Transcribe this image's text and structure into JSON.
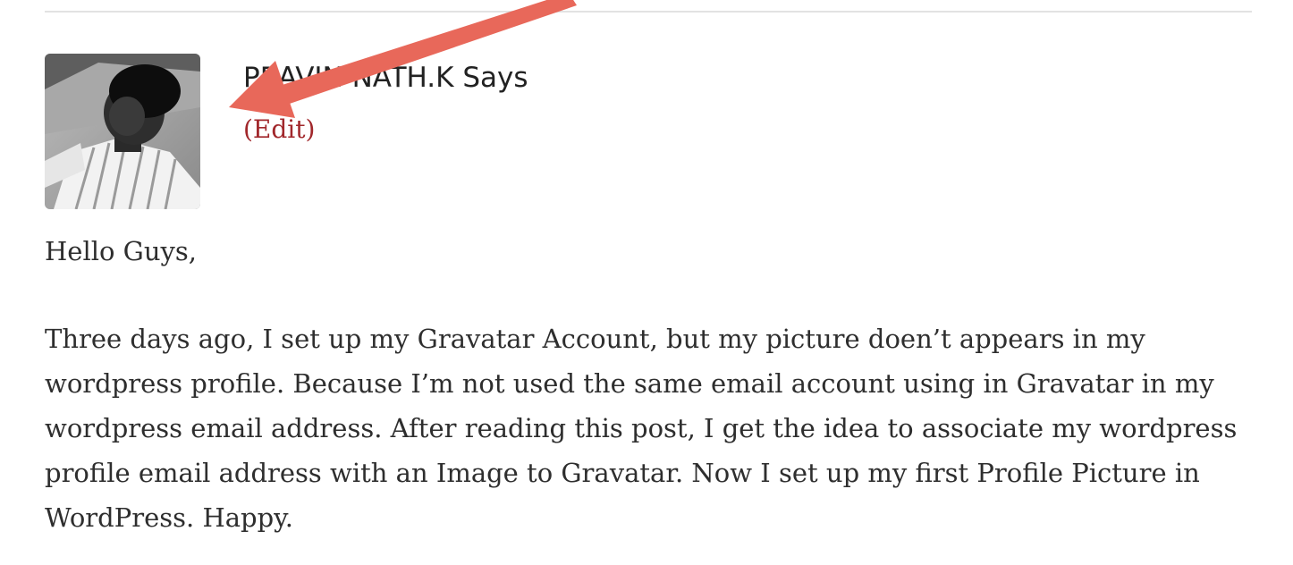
{
  "comment": {
    "author_line": "PRAVIN NATH.K Says",
    "edit_label": "(Edit)",
    "greeting": "Hello Guys,",
    "body": "Three days ago, I set up my Gravatar Account, but my picture doen’t appears in my wordpress profile. Because I’m not used the same email account using in Gravatar in my wordpress email address. After reading this post, I get the idea to associate my wordpress profile email address with an Image to Gravatar. Now I set up my first Profile Picture in WordPress. Happy."
  },
  "colors": {
    "link": "#a1272b",
    "arrow": "#e8685a",
    "divider": "#e2e2e2"
  },
  "icons": {
    "annotation": "arrow-icon"
  }
}
